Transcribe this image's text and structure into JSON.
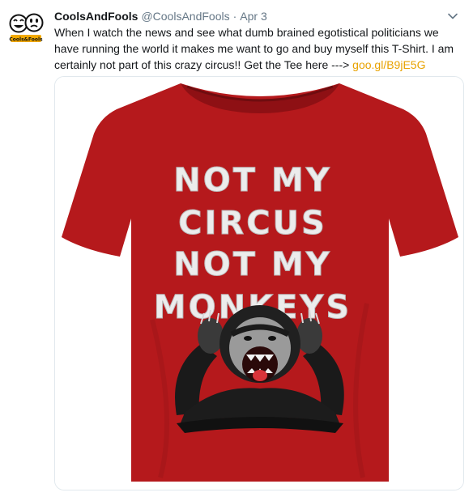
{
  "tweet": {
    "author_name": "CoolsAndFools",
    "author_handle": "@CoolsAndFools",
    "separator": "·",
    "date": "Apr 3",
    "text_main": "When I watch the news and see what dumb brained egotistical politicians we have running the world it makes me want to go and buy myself this T-Shirt. I am certainly not part of this crazy circus!! Get the Tee here ---> ",
    "link": "goo.gl/B9jE5G"
  },
  "avatar": {
    "logo_text": "Cools and Fools",
    "icon": "smiley-faces-logo"
  },
  "media": {
    "shirt_text": [
      "NOT MY",
      "CIRCUS",
      "NOT MY",
      "MONKEYS"
    ],
    "shirt_color": "#b5191c",
    "subject": "screaming-chimpanzee-covering-ears"
  },
  "colors": {
    "name": "#14171a",
    "meta": "#657786",
    "link": "#e8a200",
    "border": "#e1e8ed"
  },
  "icons": {
    "menu": "chevron-down-icon"
  }
}
